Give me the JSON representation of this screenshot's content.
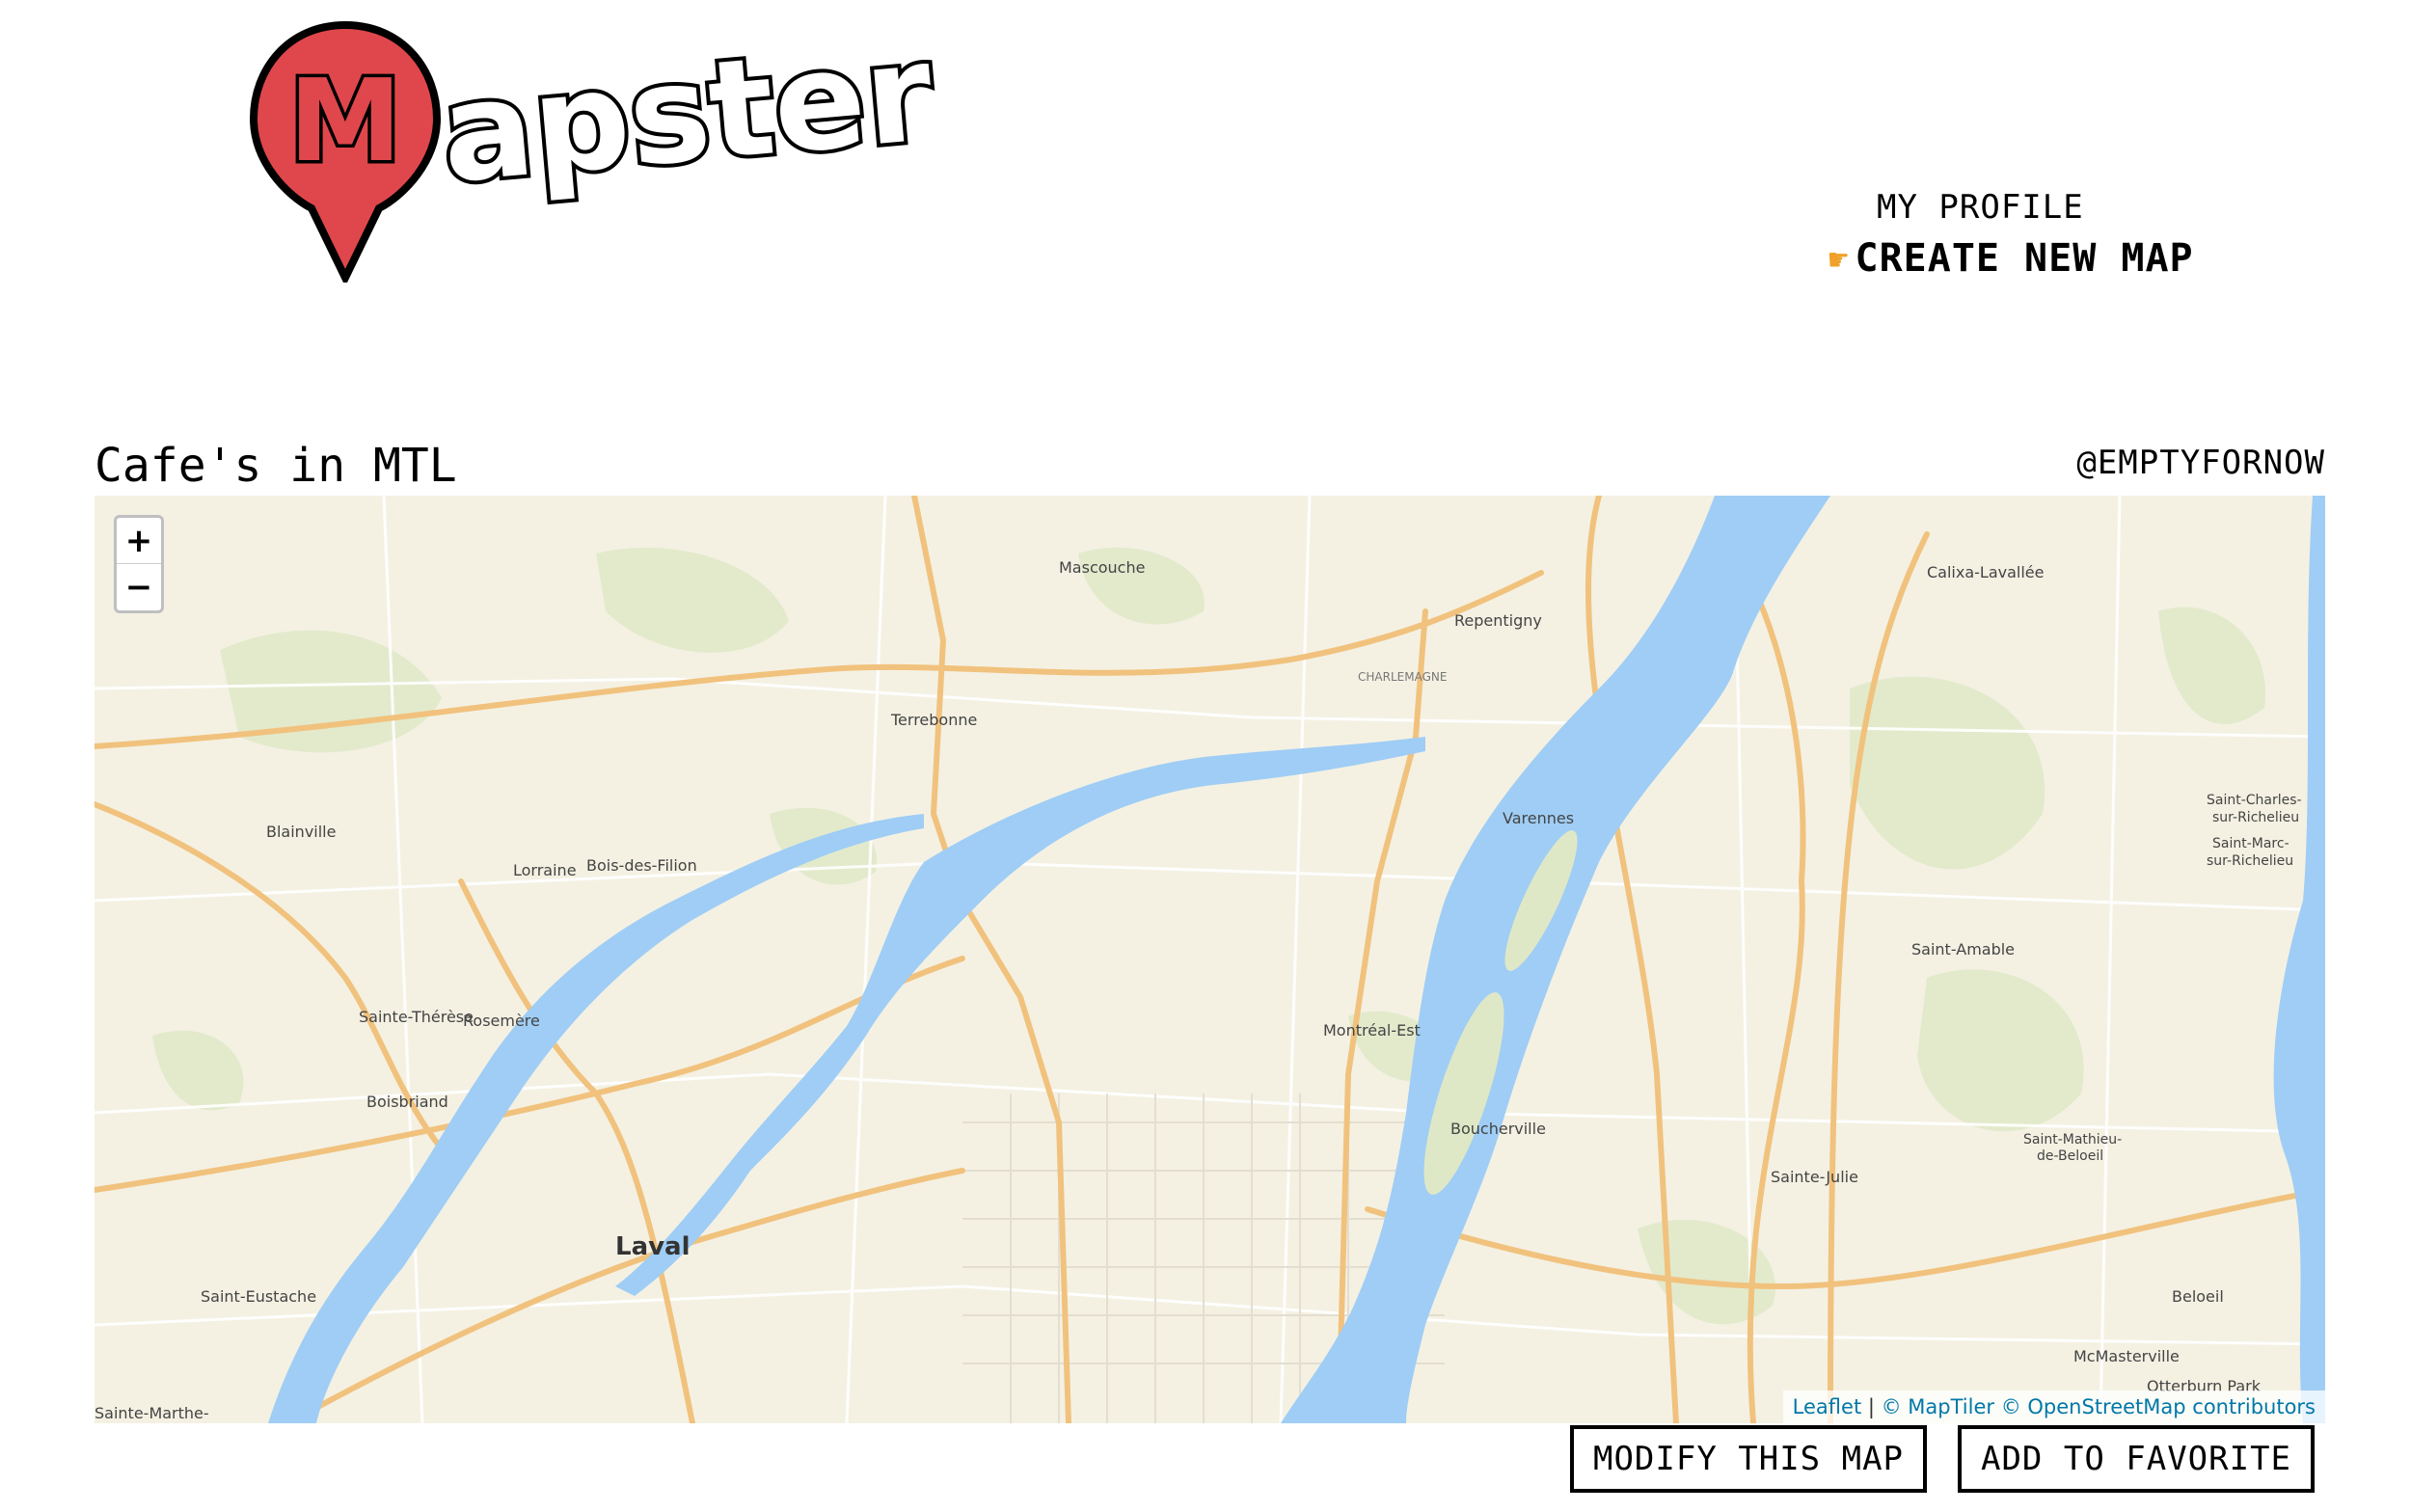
{
  "header": {
    "logo_text": "Mapster",
    "nav": {
      "profile_label": "MY PROFILE",
      "create_label": "CREATE NEW MAP",
      "create_icon": "pointing-hand-icon"
    }
  },
  "map_header": {
    "title": "Cafe's in MTL",
    "owner": "@EMPTYFORNOW"
  },
  "map": {
    "zoom_in_label": "+",
    "zoom_out_label": "−",
    "attribution": {
      "leaflet": "Leaflet",
      "sep": " | ",
      "maptiler": "© MapTiler",
      "osm": "© OpenStreetMap contributors"
    },
    "place_labels": [
      "Mascouche",
      "Repentigny",
      "Calixa-Lavallée",
      "Terrebonne",
      "Charlemagne",
      "Blainville",
      "Lorraine",
      "Bois-des-Filion",
      "Varennes",
      "Saint-Charles-sur-Richelieu",
      "Saint-Marc-sur-Richelieu",
      "Saint-Amable",
      "Montréal-Est",
      "Sainte-Thérèse",
      "Rosemère",
      "Boisbriand",
      "Boucherville",
      "Sainte-Julie",
      "Saint-Mathieu-de-Beloeil",
      "Laval",
      "Saint-Eustache",
      "Beloeil",
      "McMasterville",
      "Otterburn Park",
      "Sainte-Marthe-"
    ]
  },
  "actions": {
    "modify_label": "MODIFY THIS MAP",
    "favorite_label": "ADD TO FAVORITE"
  },
  "colors": {
    "logo_red": "#e0474c",
    "water": "#9fcdf5",
    "land": "#f4f1e3",
    "highway": "#f1c27d",
    "link": "#0078a8"
  }
}
